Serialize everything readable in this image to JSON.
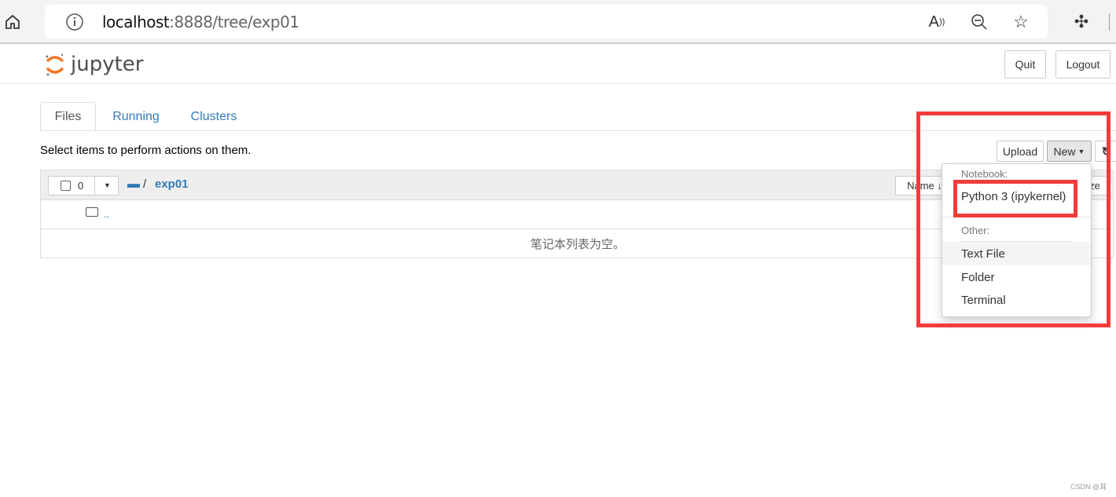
{
  "browser": {
    "url_host": "localhost",
    "url_path": ":8888/tree/exp01",
    "icons": [
      "home-icon",
      "info-icon",
      "read-aloud-icon",
      "zoom-out-icon",
      "favorite-add-icon",
      "extensions-icon"
    ]
  },
  "header": {
    "logo_text": "jupyter",
    "quit": "Quit",
    "logout": "Logout"
  },
  "tabs": [
    {
      "label": "Files",
      "active": true
    },
    {
      "label": "Running"
    },
    {
      "label": "Clusters"
    }
  ],
  "toolbar": {
    "hint": "Select items to perform actions on them.",
    "upload": "Upload",
    "new": "New"
  },
  "list": {
    "selected_count": "0",
    "breadcrumb_sep": "/",
    "folder": "exp01",
    "sort_name": "Name",
    "sort_size": "File size",
    "parent": "..",
    "empty_message": "笔记本列表为空。"
  },
  "new_menu": {
    "notebook_header": "Notebook:",
    "python": "Python 3 (ipykernel)",
    "other_header": "Other:",
    "items": [
      "Text File",
      "Folder",
      "Terminal"
    ]
  },
  "watermark": "CSDN @耳",
  "colors": {
    "annotation": "#f33b3b",
    "link": "#337ab7",
    "jupyter_orange": "#f37726"
  }
}
